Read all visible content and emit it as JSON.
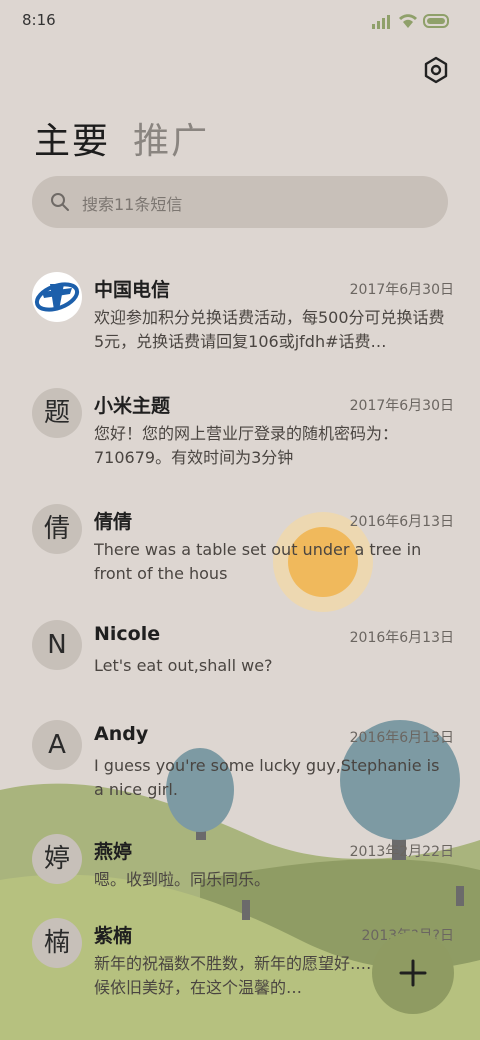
{
  "status_bar": {
    "time": "8:16"
  },
  "tabs": [
    {
      "label": "主要",
      "active": true
    },
    {
      "label": "推广",
      "active": false
    }
  ],
  "search": {
    "placeholder": "搜索11条短信"
  },
  "conversations": [
    {
      "avatar": "",
      "avatar_type": "china-telecom-logo",
      "name": "中国电信",
      "date": "2017年6月30日",
      "preview": "欢迎参加积分兑换话费活动，每500分可兑换话费5元，兑换话费请回复106或jfdh#话费…"
    },
    {
      "avatar": "题",
      "name": "小米主题",
      "date": "2017年6月30日",
      "preview": "您好！您的网上营业厅登录的随机密码为：710679。有效时间为3分钟"
    },
    {
      "avatar": "倩",
      "name": "倩倩",
      "date": "2016年6月13日",
      "preview": "There was a table set out under a tree in front of the hous"
    },
    {
      "avatar": "N",
      "name": "Nicole",
      "date": "2016年6月13日",
      "preview": "Let's eat out,shall we?"
    },
    {
      "avatar": "A",
      "name": "Andy",
      "date": "2016年6月13日",
      "preview": "I guess you're some lucky guy,Stephanie is a nice girl."
    },
    {
      "avatar": "婷",
      "name": "燕婷",
      "date": "2013年2月22日",
      "preview": "嗯。收到啦。同乐同乐。"
    },
    {
      "avatar": "楠",
      "name": "紫楠",
      "date": "2013年?月?日",
      "preview": "新年的祝福数不胜数，新年的愿望好……新年的问候依旧美好，在这个温馨的…"
    }
  ],
  "colors": {
    "background": "#ddd6d1",
    "search_bg": "#c8c0b9",
    "fab": "#8f9b62",
    "sun": "#f0b95c",
    "hills": "#a8b478"
  },
  "icons": {
    "settings": "hexagon-settings-icon",
    "search": "search-icon",
    "fab": "plus-icon"
  }
}
